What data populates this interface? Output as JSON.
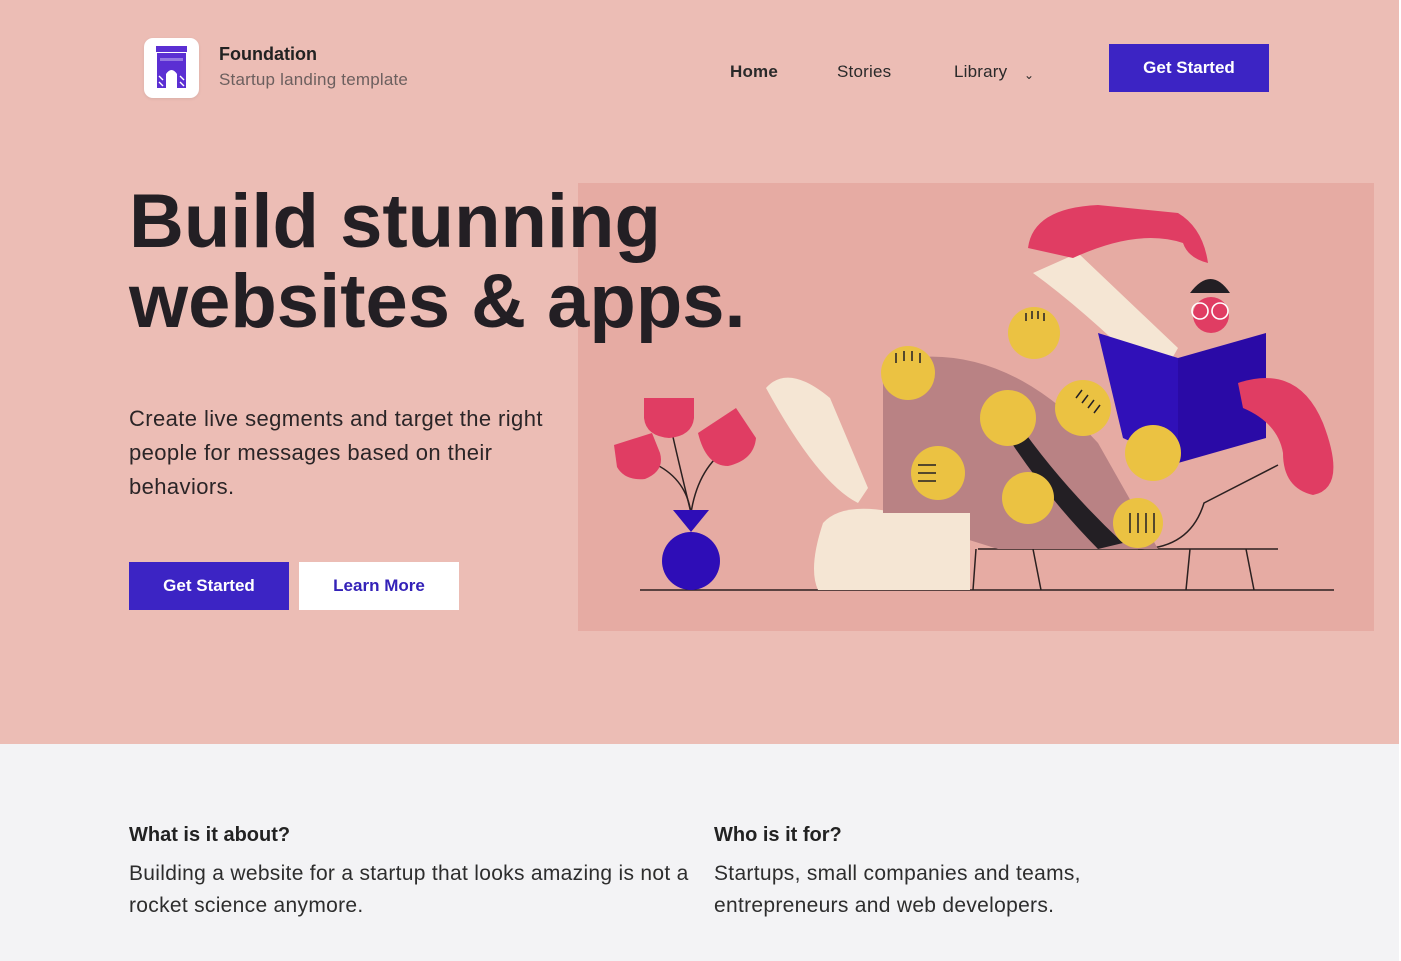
{
  "brand": {
    "name": "Foundation",
    "tagline": "Startup landing template",
    "logo_icon": "castle-tower-icon"
  },
  "nav": {
    "items": [
      {
        "label": "Home"
      },
      {
        "label": "Stories"
      },
      {
        "label": "Library"
      }
    ],
    "library_icon": "chevron-down-icon",
    "cta_label": "Get Started"
  },
  "hero": {
    "headline_line1": "Build stunning",
    "headline_line2": "websites & apps.",
    "description": "Create live segments and target the right people for messages based on their behaviors.",
    "primary_label": "Get Started",
    "secondary_label": "Learn More",
    "illustration": "person-reading-book-illustration"
  },
  "features": [
    {
      "title": "What is it about?",
      "text": "Building a website for a startup that looks amazing is not a rocket science anymore."
    },
    {
      "title": "Who is it for?",
      "text": "Startups, small companies and teams, entrepreneurs and web developers."
    }
  ],
  "colors": {
    "hero_bg": "#ecbdb5",
    "accent": "#3c24c4",
    "lower_bg": "#f3f3f5",
    "illustration_bg": "#e6aba3",
    "pink": "#e03d63",
    "yellow": "#ebc242"
  }
}
